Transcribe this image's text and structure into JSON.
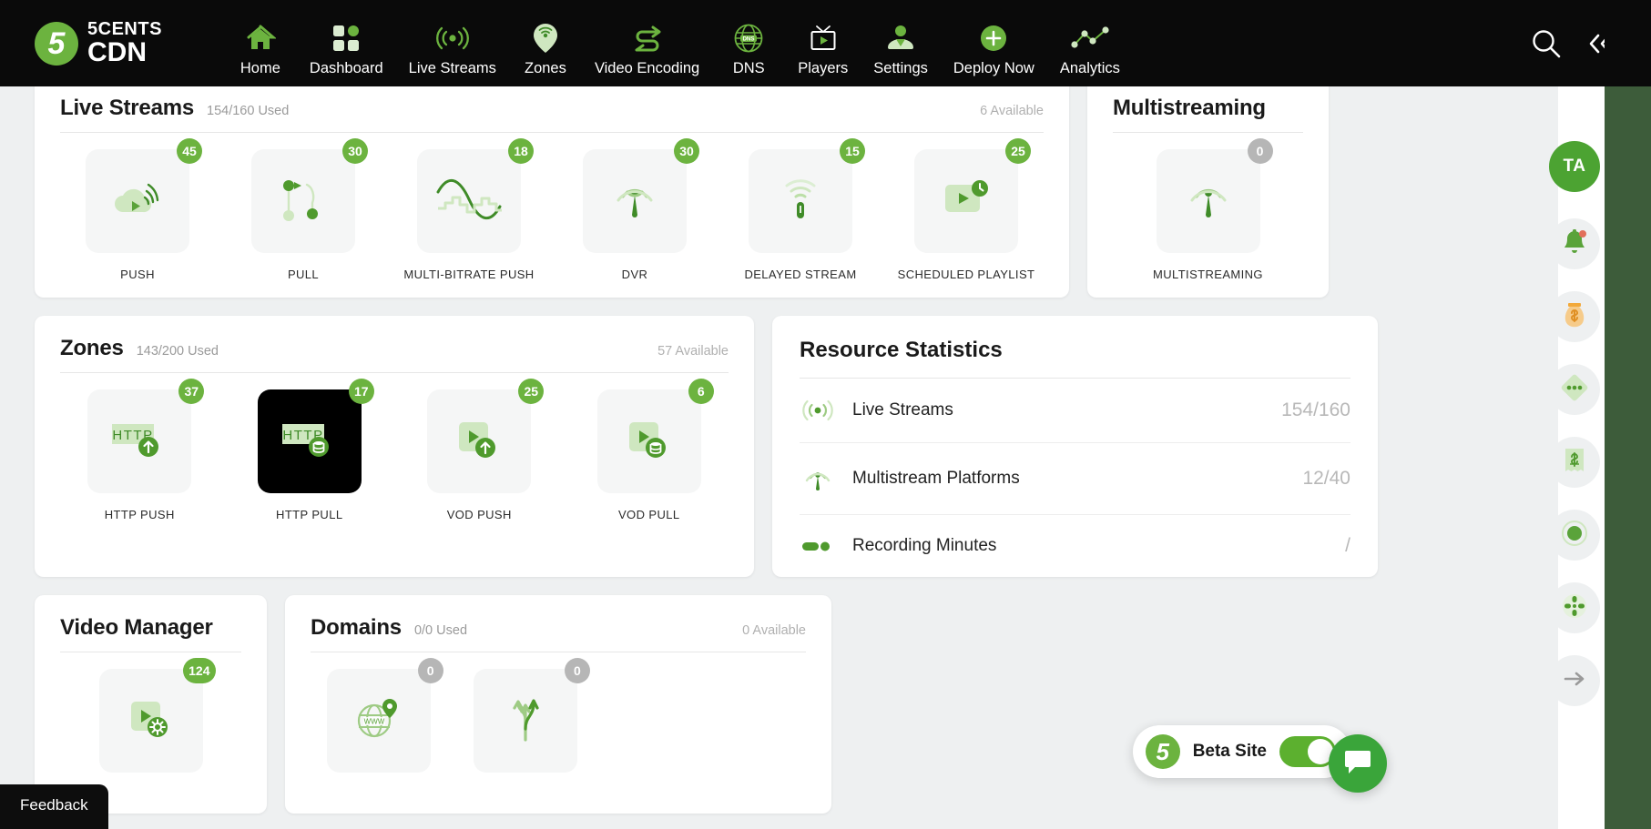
{
  "brand": {
    "line1": "5CENTS",
    "line2": "CDN",
    "mark": "5"
  },
  "nav": {
    "items": [
      {
        "label": "Home",
        "icon": "home-icon"
      },
      {
        "label": "Dashboard",
        "icon": "dashboard-grid-icon"
      },
      {
        "label": "Live Streams",
        "icon": "broadcast-icon"
      },
      {
        "label": "Zones",
        "icon": "map-pin-wifi-icon"
      },
      {
        "label": "Video Encoding",
        "icon": "transcode-arrows-icon"
      },
      {
        "label": "DNS",
        "icon": "globe-dns-icon"
      },
      {
        "label": "Players",
        "icon": "tv-play-icon"
      },
      {
        "label": "Settings",
        "icon": "user-settings-icon"
      },
      {
        "label": "Deploy Now",
        "icon": "plus-circle-icon"
      },
      {
        "label": "Analytics",
        "icon": "line-chart-icon"
      }
    ],
    "search_icon": "search-icon",
    "collapse_icon": "collapse-left-icon",
    "collapse_glyph": "«‹"
  },
  "live_streams": {
    "title": "Live Streams",
    "used": "154/160 Used",
    "available": "6 Available",
    "tiles": [
      {
        "label": "PUSH",
        "count": "45",
        "icon": "cloud-push-icon"
      },
      {
        "label": "PULL",
        "count": "30",
        "icon": "pull-nodes-icon"
      },
      {
        "label": "MULTI-BITRATE PUSH",
        "count": "18",
        "icon": "multibitrate-wave-icon"
      },
      {
        "label": "DVR",
        "count": "30",
        "icon": "dvr-broadcast-icon"
      },
      {
        "label": "DELAYED STREAM",
        "count": "15",
        "icon": "delayed-stream-icon"
      },
      {
        "label": "SCHEDULED PLAYLIST",
        "count": "25",
        "icon": "scheduled-playlist-icon"
      }
    ]
  },
  "multistreaming": {
    "title": "Multistreaming",
    "tiles": [
      {
        "label": "MULTISTREAMING",
        "count": "0",
        "icon": "multistream-broadcast-icon",
        "badge_grey": true
      }
    ]
  },
  "zones": {
    "title": "Zones",
    "used": "143/200 Used",
    "available": "57 Available",
    "tiles": [
      {
        "label": "HTTP PUSH",
        "count": "37",
        "icon": "http-push-icon",
        "dark": false
      },
      {
        "label": "HTTP PULL",
        "count": "17",
        "icon": "http-pull-icon",
        "dark": true
      },
      {
        "label": "VOD PUSH",
        "count": "25",
        "icon": "vod-push-icon",
        "dark": false
      },
      {
        "label": "VOD PULL",
        "count": "6",
        "icon": "vod-pull-icon",
        "dark": false
      }
    ]
  },
  "resource_statistics": {
    "title": "Resource Statistics",
    "rows": [
      {
        "name": "Live Streams",
        "value": "154/160",
        "icon": "broadcast-icon"
      },
      {
        "name": "Multistream Platforms",
        "value": "12/40",
        "icon": "multistream-broadcast-icon"
      },
      {
        "name": "Recording Minutes",
        "value": "/",
        "icon": "recording-dots-icon"
      }
    ]
  },
  "video_manager": {
    "title": "Video Manager",
    "tiles": [
      {
        "label": "",
        "count": "124",
        "icon": "video-settings-icon"
      }
    ]
  },
  "domains": {
    "title": "Domains",
    "used": "0/0 Used",
    "available": "0 Available",
    "tiles": [
      {
        "label": "",
        "count": "0",
        "icon": "www-globe-pin-icon",
        "badge_grey": true
      },
      {
        "label": "",
        "count": "0",
        "icon": "branch-arrows-icon",
        "badge_grey": true
      }
    ]
  },
  "rail": {
    "avatar": "TA",
    "items": [
      {
        "icon": "bell-icon",
        "has_dot": true
      },
      {
        "icon": "money-bag-icon"
      },
      {
        "icon": "diamond-dots-icon"
      },
      {
        "icon": "dollar-receipt-icon"
      },
      {
        "icon": "record-dot-icon"
      },
      {
        "icon": "move-cross-icon"
      },
      {
        "icon": "arrow-right-icon"
      }
    ]
  },
  "beta": {
    "label": "Beta Site",
    "mark": "5",
    "enabled": true
  },
  "chat": {
    "icon": "chat-bubble-icon"
  },
  "feedback": {
    "label": "Feedback"
  },
  "colors": {
    "green": "#6cb33f",
    "dark_green": "#4ca332",
    "black": "#0a0a0a",
    "grey_badge": "#b6b6b6",
    "bg": "#eef0f1"
  }
}
